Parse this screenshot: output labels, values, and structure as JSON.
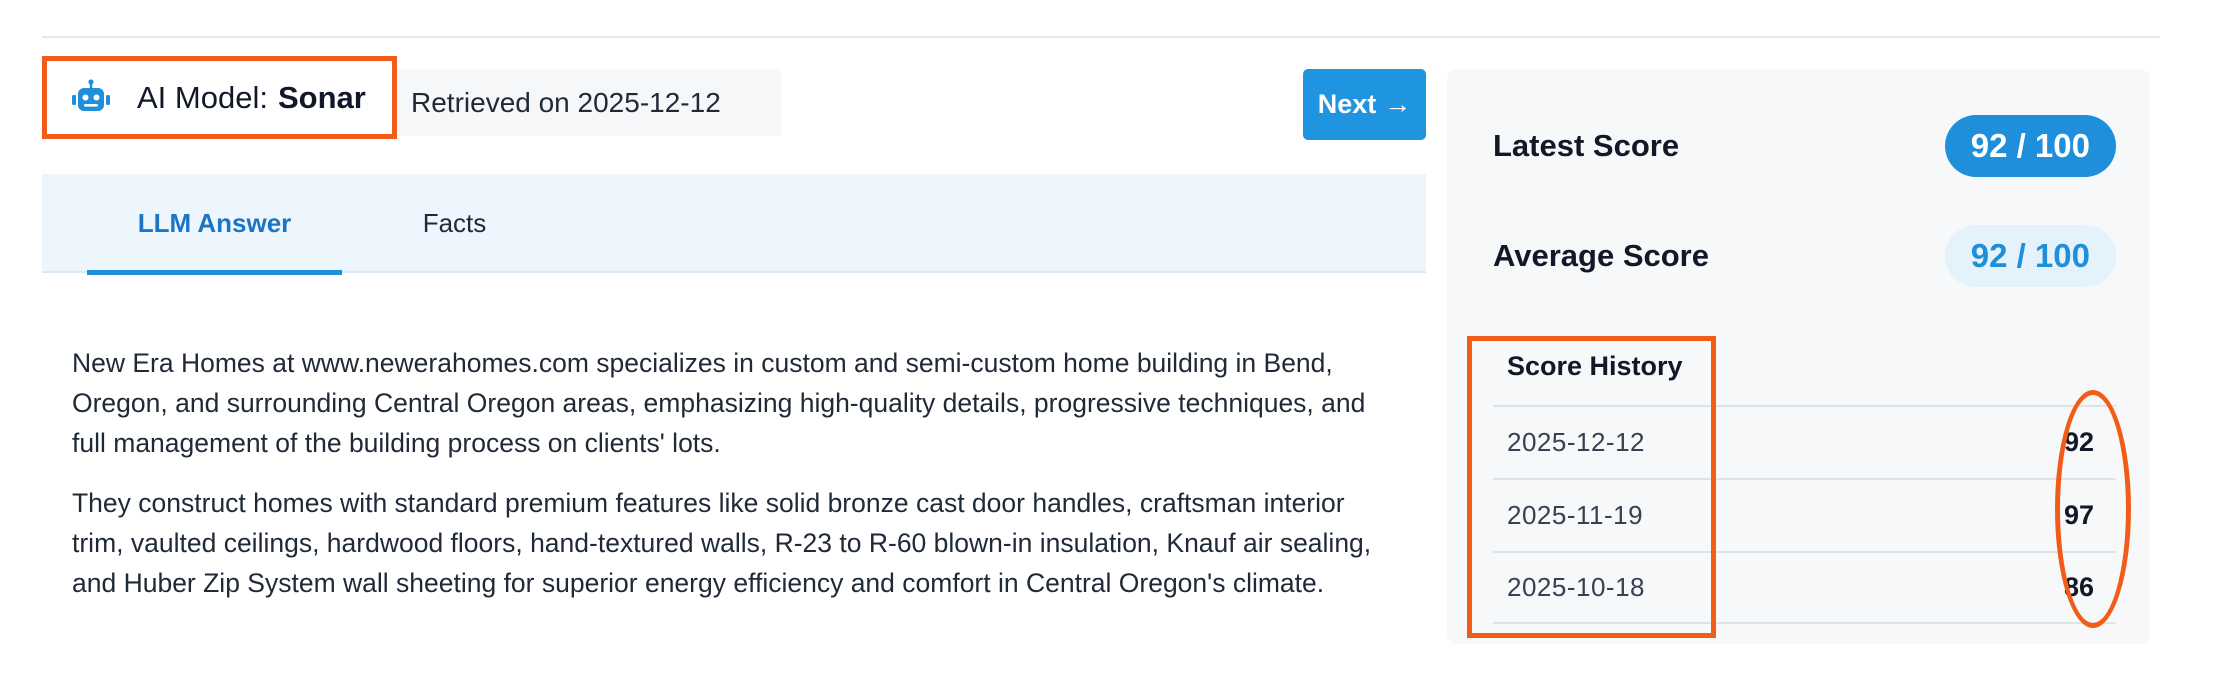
{
  "header": {
    "model_label": "AI Model:",
    "model_name": "Sonar",
    "retrieved": "Retrieved on 2025-12-12",
    "next_label": "Next",
    "next_arrow": "→"
  },
  "tabs": [
    {
      "label": "LLM Answer",
      "active": true
    },
    {
      "label": "Facts",
      "active": false
    }
  ],
  "answer": {
    "paragraphs": [
      "New Era Homes at www.newerahomes.com specializes in custom and semi-custom home building in Bend, Oregon, and surrounding Central Oregon areas, emphasizing high-quality details, progressive techniques, and full management of the building process on clients' lots.",
      "They construct homes with standard premium features like solid bronze cast door handles, craftsman interior trim, vaulted ceilings, hardwood floors, hand-textured walls, R-23 to R-60 blown-in insulation, Knauf air sealing, and Huber Zip System wall sheeting for superior energy efficiency and comfort in Central Oregon's climate."
    ]
  },
  "scores": {
    "latest_label": "Latest Score",
    "latest_value": "92 / 100",
    "average_label": "Average Score",
    "average_value": "92 / 100",
    "history_title": "Score History",
    "history": [
      {
        "date": "2025-12-12",
        "score": "92"
      },
      {
        "date": "2025-11-19",
        "score": "97"
      },
      {
        "date": "2025-10-18",
        "score": "86"
      }
    ]
  },
  "icons": {
    "model": "robot-icon",
    "next": "arrow-right-icon"
  },
  "colors": {
    "accent": "#1f8fdc",
    "highlight": "#f25c19",
    "panel": "#f6f8fa",
    "tab_bar": "#eef6fd"
  }
}
